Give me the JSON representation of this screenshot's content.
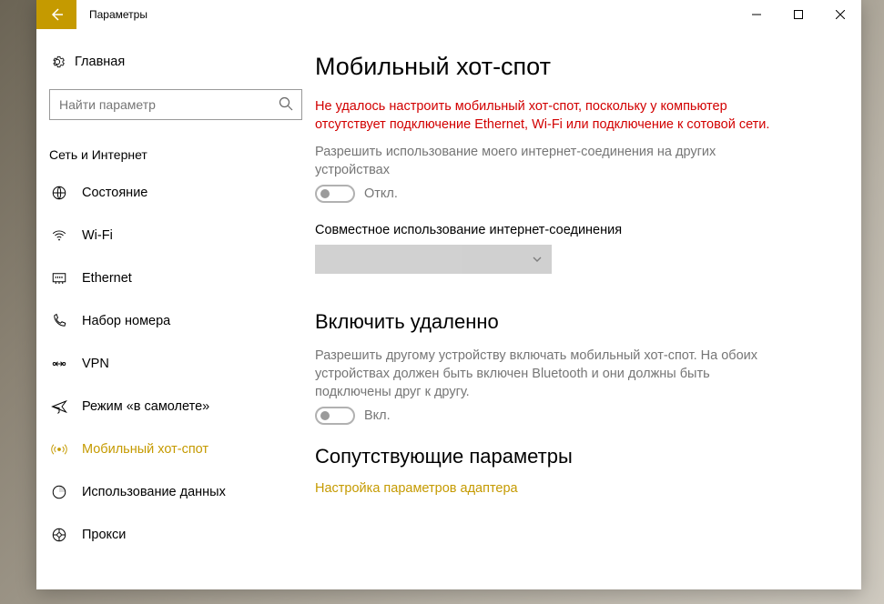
{
  "window": {
    "title": "Параметры"
  },
  "sidebar": {
    "home": "Главная",
    "search_placeholder": "Найти параметр",
    "group": "Сеть и Интернет",
    "items": [
      {
        "label": "Состояние"
      },
      {
        "label": "Wi-Fi"
      },
      {
        "label": "Ethernet"
      },
      {
        "label": "Набор номера"
      },
      {
        "label": "VPN"
      },
      {
        "label": "Режим «в самолете»"
      },
      {
        "label": "Мобильный хот-спот"
      },
      {
        "label": "Использование данных"
      },
      {
        "label": "Прокси"
      }
    ]
  },
  "main": {
    "heading": "Мобильный хот-спот",
    "error": "Не удалось настроить мобильный хот-спот, поскольку у компьютер отсутствует подключение Ethernet, Wi-Fi или подключение к сотовой сети.",
    "share_desc": "Разрешить использование моего интернет-соединения на других устройствах",
    "toggle1_label": "Откл.",
    "share_from_label": "Совместное использование интернет-соединения",
    "section2_title": "Включить удаленно",
    "section2_desc": "Разрешить другому устройству включать мобильный хот-спот. На обоих устройствах должен быть включен Bluetooth и они должны быть подключены друг к другу.",
    "toggle2_label": "Вкл.",
    "section3_title": "Сопутствующие параметры",
    "adapter_link": "Настройка параметров адаптера"
  },
  "colors": {
    "accent": "#c59a00",
    "error": "#d20000"
  }
}
